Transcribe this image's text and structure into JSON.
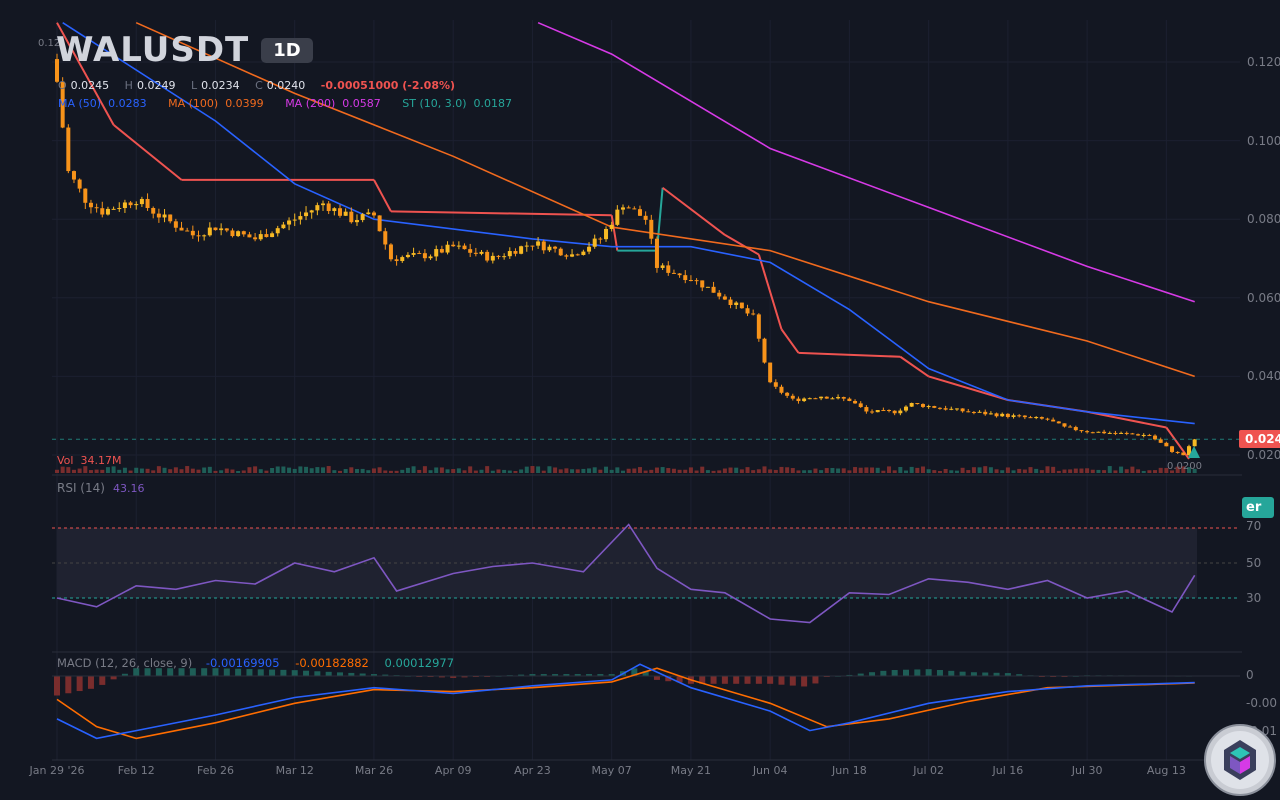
{
  "header": {
    "symbol": "WALUSDT",
    "timeframe": "1D",
    "ohlc": {
      "o_key": "O",
      "o": "0.0245",
      "h_key": "H",
      "h": "0.0249",
      "l_key": "L",
      "l": "0.0234",
      "c_key": "C",
      "c": "0.0240",
      "change": "-0.00051000 (-2.08%)"
    },
    "top_left_value": "0.12"
  },
  "indicators": {
    "ma50": {
      "label": "MA (50)",
      "value": "0.0283",
      "color": "#2962ff"
    },
    "ma100": {
      "label": "MA (100)",
      "value": "0.0399",
      "color": "#f06a1e"
    },
    "ma200": {
      "label": "MA (200)",
      "value": "0.0587",
      "color": "#d63ae6"
    },
    "st": {
      "label": "ST (10, 3.0)",
      "value": "0.0187",
      "color": "#26a69a"
    }
  },
  "volume": {
    "label": "Vol",
    "value": "34.17M"
  },
  "rsi": {
    "label": "RSI (14)",
    "value": "43.16",
    "levels": [
      "70",
      "50",
      "30"
    ]
  },
  "macd": {
    "label": "MACD (12, 26, close, 9)",
    "macd": "-0.00169905",
    "signal": "-0.00182882",
    "hist": "0.00012977",
    "axis": [
      "0",
      "-0.00",
      "-0.01"
    ]
  },
  "price_axis": [
    "0.120",
    "0.100",
    "0.080",
    "0.060",
    "0.040",
    "0.020"
  ],
  "last_price_tag": "0.024",
  "low_label": "0.0200",
  "side_tag": "er",
  "x_axis": [
    "Jan 29 '26",
    "Feb 12",
    "Feb 26",
    "Mar 12",
    "Mar 26",
    "Apr 09",
    "Apr 23",
    "May 07",
    "May 21",
    "Jun 04",
    "Jun 18",
    "Jul 02",
    "Jul 16",
    "Jul 30",
    "Aug 13"
  ],
  "colors": {
    "bg": "#131722",
    "up": "#f7b924",
    "down": "#f7931a",
    "supertrend_down": "#ef5350",
    "supertrend_up": "#26a69a",
    "rsi": "#7e57c2",
    "macd": "#2962ff",
    "signal": "#ff6d00"
  },
  "chart_data": {
    "type": "candlestick",
    "title": "WALUSDT 1D",
    "x_range": [
      "2026-01-29",
      "2026-08-18"
    ],
    "ylim": [
      0.015,
      0.13
    ],
    "close_anchors": [
      {
        "date": "2026-01-29",
        "value": 0.115
      },
      {
        "date": "2026-01-31",
        "value": 0.092
      },
      {
        "date": "2026-02-03",
        "value": 0.085
      },
      {
        "date": "2026-02-06",
        "value": 0.082
      },
      {
        "date": "2026-02-12",
        "value": 0.085
      },
      {
        "date": "2026-02-16",
        "value": 0.081
      },
      {
        "date": "2026-02-22",
        "value": 0.076
      },
      {
        "date": "2026-02-26",
        "value": 0.078
      },
      {
        "date": "2026-03-05",
        "value": 0.075
      },
      {
        "date": "2026-03-12",
        "value": 0.08
      },
      {
        "date": "2026-03-17",
        "value": 0.084
      },
      {
        "date": "2026-03-22",
        "value": 0.08
      },
      {
        "date": "2026-03-26",
        "value": 0.081
      },
      {
        "date": "2026-03-29",
        "value": 0.07
      },
      {
        "date": "2026-04-05",
        "value": 0.071
      },
      {
        "date": "2026-04-09",
        "value": 0.073
      },
      {
        "date": "2026-04-16",
        "value": 0.07
      },
      {
        "date": "2026-04-23",
        "value": 0.074
      },
      {
        "date": "2026-04-30",
        "value": 0.071
      },
      {
        "date": "2026-05-05",
        "value": 0.075
      },
      {
        "date": "2026-05-09",
        "value": 0.084
      },
      {
        "date": "2026-05-13",
        "value": 0.08
      },
      {
        "date": "2026-05-15",
        "value": 0.068
      },
      {
        "date": "2026-05-21",
        "value": 0.065
      },
      {
        "date": "2026-05-27",
        "value": 0.06
      },
      {
        "date": "2026-06-01",
        "value": 0.055
      },
      {
        "date": "2026-06-04",
        "value": 0.038
      },
      {
        "date": "2026-06-08",
        "value": 0.034
      },
      {
        "date": "2026-06-13",
        "value": 0.035
      },
      {
        "date": "2026-06-18",
        "value": 0.034
      },
      {
        "date": "2026-06-21",
        "value": 0.031
      },
      {
        "date": "2026-06-26",
        "value": 0.031
      },
      {
        "date": "2026-06-29",
        "value": 0.033
      },
      {
        "date": "2026-07-09",
        "value": 0.031
      },
      {
        "date": "2026-07-16",
        "value": 0.03
      },
      {
        "date": "2026-07-23",
        "value": 0.029
      },
      {
        "date": "2026-07-26",
        "value": 0.027
      },
      {
        "date": "2026-07-30",
        "value": 0.026
      },
      {
        "date": "2026-08-10",
        "value": 0.025
      },
      {
        "date": "2026-08-14",
        "value": 0.021
      },
      {
        "date": "2026-08-16",
        "value": 0.02
      },
      {
        "date": "2026-08-18",
        "value": 0.024
      }
    ],
    "ma50": [
      {
        "date": "2026-01-30",
        "value": 0.13
      },
      {
        "date": "2026-02-26",
        "value": 0.105
      },
      {
        "date": "2026-03-12",
        "value": 0.089
      },
      {
        "date": "2026-03-26",
        "value": 0.08
      },
      {
        "date": "2026-04-23",
        "value": 0.075
      },
      {
        "date": "2026-05-07",
        "value": 0.073
      },
      {
        "date": "2026-05-21",
        "value": 0.073
      },
      {
        "date": "2026-06-04",
        "value": 0.069
      },
      {
        "date": "2026-06-18",
        "value": 0.057
      },
      {
        "date": "2026-07-02",
        "value": 0.042
      },
      {
        "date": "2026-07-16",
        "value": 0.034
      },
      {
        "date": "2026-07-30",
        "value": 0.031
      },
      {
        "date": "2026-08-18",
        "value": 0.028
      }
    ],
    "ma100": [
      {
        "date": "2026-02-12",
        "value": 0.13
      },
      {
        "date": "2026-03-12",
        "value": 0.112
      },
      {
        "date": "2026-04-09",
        "value": 0.096
      },
      {
        "date": "2026-05-07",
        "value": 0.078
      },
      {
        "date": "2026-06-04",
        "value": 0.072
      },
      {
        "date": "2026-07-02",
        "value": 0.059
      },
      {
        "date": "2026-07-30",
        "value": 0.049
      },
      {
        "date": "2026-08-18",
        "value": 0.04
      }
    ],
    "ma200": [
      {
        "date": "2026-04-24",
        "value": 0.13
      },
      {
        "date": "2026-05-07",
        "value": 0.122
      },
      {
        "date": "2026-06-04",
        "value": 0.098
      },
      {
        "date": "2026-07-02",
        "value": 0.083
      },
      {
        "date": "2026-07-30",
        "value": 0.068
      },
      {
        "date": "2026-08-18",
        "value": 0.059
      }
    ],
    "supertrend": [
      {
        "date": "2026-01-29",
        "value": 0.13,
        "dir": "down"
      },
      {
        "date": "2026-02-08",
        "value": 0.104,
        "dir": "down"
      },
      {
        "date": "2026-02-20",
        "value": 0.09,
        "dir": "down"
      },
      {
        "date": "2026-03-26",
        "value": 0.09,
        "dir": "down"
      },
      {
        "date": "2026-03-29",
        "value": 0.082,
        "dir": "down"
      },
      {
        "date": "2026-05-07",
        "value": 0.081,
        "dir": "down"
      },
      {
        "date": "2026-05-08",
        "value": 0.072,
        "dir": "up"
      },
      {
        "date": "2026-05-15",
        "value": 0.072,
        "dir": "up"
      },
      {
        "date": "2026-05-16",
        "value": 0.088,
        "dir": "down"
      },
      {
        "date": "2026-05-27",
        "value": 0.076,
        "dir": "down"
      },
      {
        "date": "2026-06-02",
        "value": 0.071,
        "dir": "down"
      },
      {
        "date": "2026-06-06",
        "value": 0.052,
        "dir": "down"
      },
      {
        "date": "2026-06-09",
        "value": 0.046,
        "dir": "down"
      },
      {
        "date": "2026-06-27",
        "value": 0.045,
        "dir": "down"
      },
      {
        "date": "2026-07-02",
        "value": 0.04,
        "dir": "down"
      },
      {
        "date": "2026-07-16",
        "value": 0.034,
        "dir": "down"
      },
      {
        "date": "2026-07-30",
        "value": 0.031,
        "dir": "down"
      },
      {
        "date": "2026-08-13",
        "value": 0.027,
        "dir": "down"
      },
      {
        "date": "2026-08-17",
        "value": 0.019,
        "dir": "up"
      }
    ],
    "rsi": [
      {
        "date": "2026-01-29",
        "value": 30
      },
      {
        "date": "2026-02-05",
        "value": 25
      },
      {
        "date": "2026-02-12",
        "value": 37
      },
      {
        "date": "2026-02-19",
        "value": 35
      },
      {
        "date": "2026-02-26",
        "value": 40
      },
      {
        "date": "2026-03-05",
        "value": 38
      },
      {
        "date": "2026-03-12",
        "value": 50
      },
      {
        "date": "2026-03-19",
        "value": 45
      },
      {
        "date": "2026-03-26",
        "value": 53
      },
      {
        "date": "2026-03-30",
        "value": 34
      },
      {
        "date": "2026-04-09",
        "value": 44
      },
      {
        "date": "2026-04-16",
        "value": 48
      },
      {
        "date": "2026-04-23",
        "value": 50
      },
      {
        "date": "2026-05-02",
        "value": 45
      },
      {
        "date": "2026-05-10",
        "value": 72
      },
      {
        "date": "2026-05-15",
        "value": 47
      },
      {
        "date": "2026-05-21",
        "value": 35
      },
      {
        "date": "2026-05-27",
        "value": 33
      },
      {
        "date": "2026-06-04",
        "value": 18
      },
      {
        "date": "2026-06-11",
        "value": 16
      },
      {
        "date": "2026-06-18",
        "value": 33
      },
      {
        "date": "2026-06-25",
        "value": 32
      },
      {
        "date": "2026-07-02",
        "value": 41
      },
      {
        "date": "2026-07-09",
        "value": 39
      },
      {
        "date": "2026-07-16",
        "value": 35
      },
      {
        "date": "2026-07-23",
        "value": 40
      },
      {
        "date": "2026-07-30",
        "value": 30
      },
      {
        "date": "2026-08-06",
        "value": 34
      },
      {
        "date": "2026-08-14",
        "value": 22
      },
      {
        "date": "2026-08-18",
        "value": 43
      }
    ],
    "macd_line": [
      {
        "date": "2026-01-29",
        "value": -0.011
      },
      {
        "date": "2026-02-05",
        "value": -0.016
      },
      {
        "date": "2026-02-12",
        "value": -0.014
      },
      {
        "date": "2026-02-26",
        "value": -0.01
      },
      {
        "date": "2026-03-12",
        "value": -0.0055
      },
      {
        "date": "2026-03-26",
        "value": -0.003
      },
      {
        "date": "2026-04-09",
        "value": -0.0045
      },
      {
        "date": "2026-04-23",
        "value": -0.0025
      },
      {
        "date": "2026-05-07",
        "value": -0.001
      },
      {
        "date": "2026-05-12",
        "value": 0.003
      },
      {
        "date": "2026-05-21",
        "value": -0.003
      },
      {
        "date": "2026-06-04",
        "value": -0.009
      },
      {
        "date": "2026-06-11",
        "value": -0.014
      },
      {
        "date": "2026-06-18",
        "value": -0.012
      },
      {
        "date": "2026-07-02",
        "value": -0.007
      },
      {
        "date": "2026-07-16",
        "value": -0.004
      },
      {
        "date": "2026-07-30",
        "value": -0.0025
      },
      {
        "date": "2026-08-18",
        "value": -0.0017
      }
    ],
    "signal_line": [
      {
        "date": "2026-01-29",
        "value": -0.006
      },
      {
        "date": "2026-02-05",
        "value": -0.013
      },
      {
        "date": "2026-02-12",
        "value": -0.016
      },
      {
        "date": "2026-02-26",
        "value": -0.012
      },
      {
        "date": "2026-03-12",
        "value": -0.007
      },
      {
        "date": "2026-03-26",
        "value": -0.0035
      },
      {
        "date": "2026-04-09",
        "value": -0.004
      },
      {
        "date": "2026-04-23",
        "value": -0.003
      },
      {
        "date": "2026-05-07",
        "value": -0.0015
      },
      {
        "date": "2026-05-15",
        "value": 0.002
      },
      {
        "date": "2026-05-21",
        "value": -0.001
      },
      {
        "date": "2026-06-04",
        "value": -0.007
      },
      {
        "date": "2026-06-14",
        "value": -0.013
      },
      {
        "date": "2026-06-25",
        "value": -0.011
      },
      {
        "date": "2026-07-09",
        "value": -0.0065
      },
      {
        "date": "2026-07-23",
        "value": -0.003
      },
      {
        "date": "2026-08-18",
        "value": -0.0018
      }
    ]
  }
}
